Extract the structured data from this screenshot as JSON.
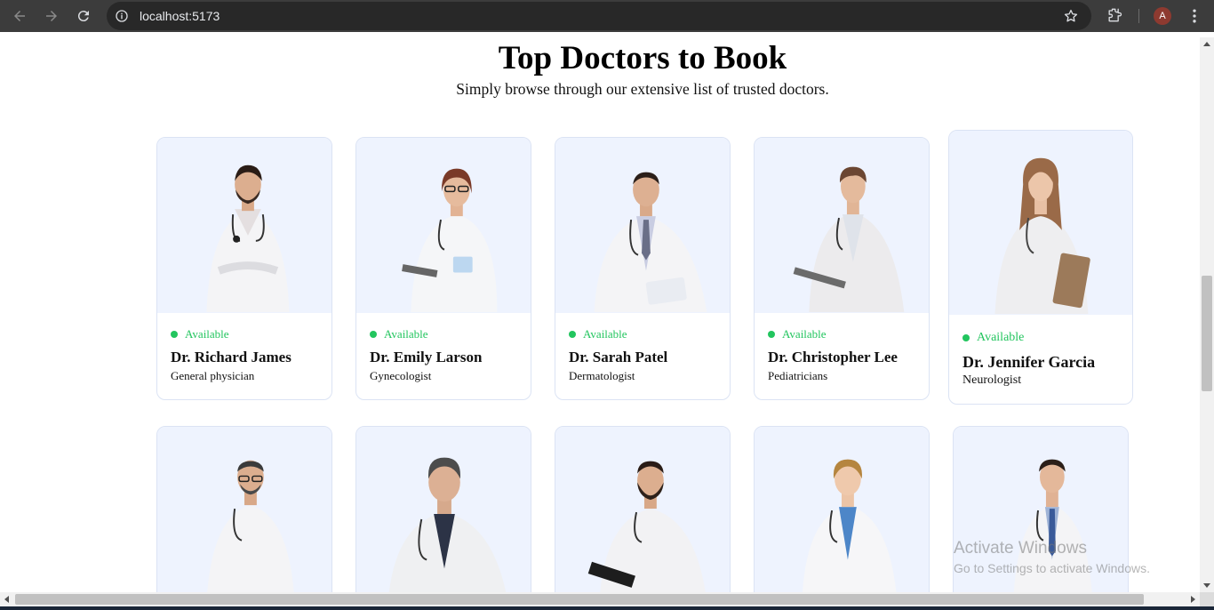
{
  "browser": {
    "url": "localhost:5173",
    "profile_initial": "A",
    "icons": [
      "back-arrow-icon",
      "forward-arrow-icon",
      "reload-icon",
      "site-info-icon",
      "bookmark-star-icon",
      "extensions-puzzle-icon",
      "kebab-menu-icon"
    ]
  },
  "page": {
    "title": "Top Doctors to Book",
    "subtitle": "Simply browse through our extensive list of trusted doctors."
  },
  "doctors": [
    {
      "status": "Available",
      "name": "Dr. Richard James",
      "speciality": "General physician"
    },
    {
      "status": "Available",
      "name": "Dr. Emily Larson",
      "speciality": "Gynecologist"
    },
    {
      "status": "Available",
      "name": "Dr. Sarah Patel",
      "speciality": "Dermatologist"
    },
    {
      "status": "Available",
      "name": "Dr. Christopher Lee",
      "speciality": "Pediatricians"
    },
    {
      "status": "Available",
      "name": "Dr. Jennifer Garcia",
      "speciality": "Neurologist"
    }
  ],
  "watermark": {
    "line1": "Activate Windows",
    "line2": "Go to Settings to activate Windows."
  },
  "colors": {
    "accent_available": "#22c55e",
    "card_photo_bg": "#eef3fe",
    "card_border": "#dbe3f4",
    "chrome_bg": "#3c3c3c"
  }
}
